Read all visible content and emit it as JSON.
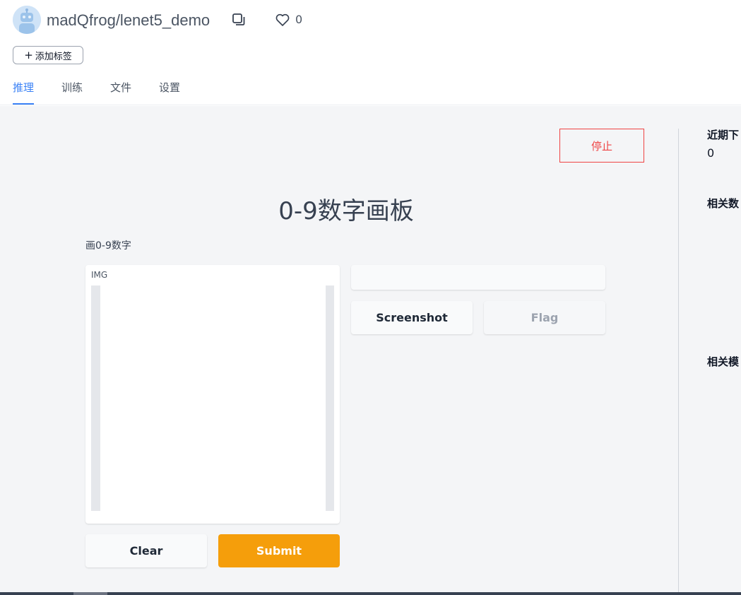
{
  "header": {
    "repo_title": "madQfrog/lenet5_demo",
    "like_count": "0",
    "add_tag_label": "添加标签"
  },
  "tabs": [
    {
      "label": "推理",
      "active": true
    },
    {
      "label": "训练",
      "active": false
    },
    {
      "label": "文件",
      "active": false
    },
    {
      "label": "设置",
      "active": false
    }
  ],
  "main": {
    "stop_label": "停止",
    "app_title": "0-9数字画板",
    "app_description": "画0-9数字",
    "input_label": "IMG",
    "screenshot_label": "Screenshot",
    "flag_label": "Flag",
    "clear_label": "Clear",
    "submit_label": "Submit"
  },
  "sidebar": {
    "recent_downloads_label": "近期下",
    "recent_downloads_value": "0",
    "related_datasets_label": "相关数",
    "related_models_label": "相关模"
  },
  "icons": {
    "avatar": "robot-avatar-icon",
    "copy": "copy-icon",
    "like": "heart-icon",
    "add": "plus-icon"
  },
  "colors": {
    "accent": "#3b82f6",
    "stop": "#ef4444",
    "submit": "#f59e0b"
  }
}
